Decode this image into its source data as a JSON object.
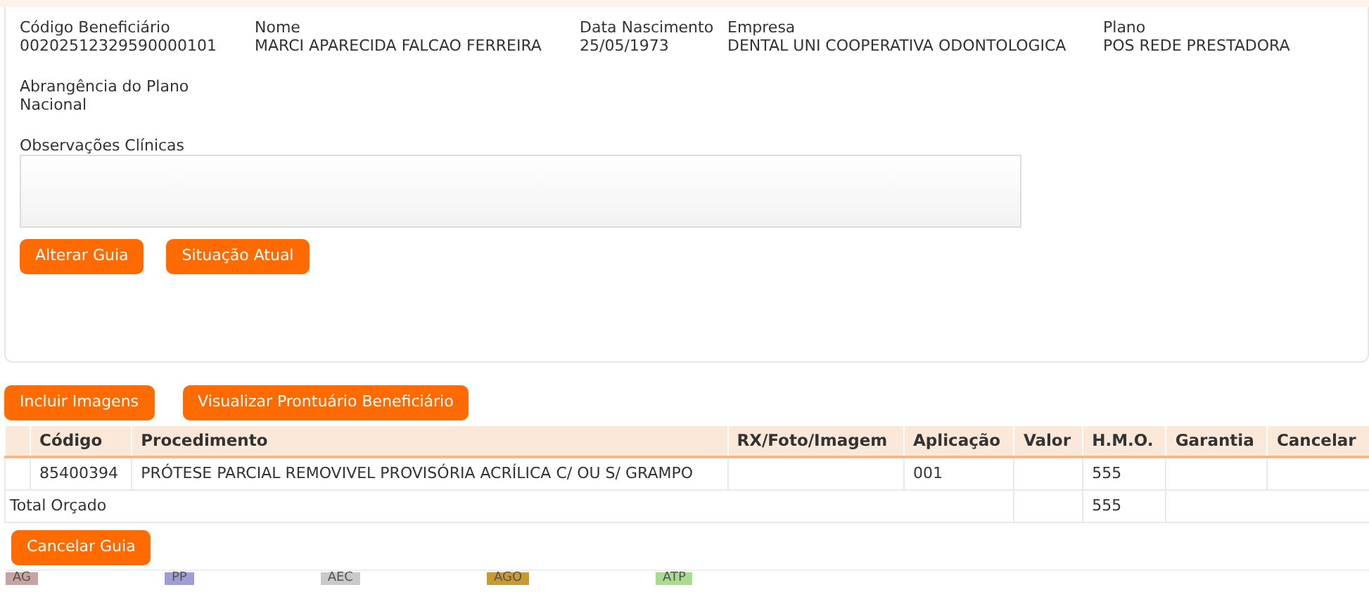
{
  "beneficiary": {
    "fields": [
      {
        "label": "Código Beneficiário",
        "value": "00202512329590000101"
      },
      {
        "label": "Nome",
        "value": "MARCI APARECIDA FALCAO FERREIRA"
      },
      {
        "label": "Data Nascimento",
        "value": "25/05/1973"
      },
      {
        "label": "Empresa",
        "value": "DENTAL UNI COOPERATIVA ODONTOLOGICA"
      },
      {
        "label": "Plano",
        "value": "POS REDE PRESTADORA"
      }
    ],
    "coverage": {
      "label": "Abrangência do Plano",
      "value": "Nacional"
    },
    "notes": {
      "label": "Observações Clínicas"
    },
    "buttons": [
      "Alterar Guia",
      "Situação Atual"
    ]
  },
  "actions": [
    "Incluir Imagens",
    "Visualizar Prontuário Beneficiário"
  ],
  "table": {
    "columns": [
      "Código",
      "Procedimento",
      "RX/Foto/Imagem",
      "Aplicação",
      "Valor",
      "H.M.O.",
      "Garantia",
      "Cancelar"
    ],
    "rows": [
      {
        "codigo": "85400394",
        "procedimento": "PRÓTESE PARCIAL REMOVIVEL PROVISÓRIA ACRÍLICA C/ OU S/ GRAMPO",
        "aplicacao": "001",
        "hmo": "555"
      }
    ],
    "total": {
      "label": "Total Orçado",
      "hmo": "555"
    }
  },
  "cancel_button": "Cancelar Guia",
  "legend": [
    {
      "label": "AG",
      "color": "#c9a3a3"
    },
    {
      "label": "PP",
      "color": "#9e9ed6"
    },
    {
      "label": "AEC",
      "color": "#c9c9c9"
    },
    {
      "label": "AGO",
      "color": "#c99a30"
    },
    {
      "label": "ATP",
      "color": "#a9dc8f"
    }
  ]
}
